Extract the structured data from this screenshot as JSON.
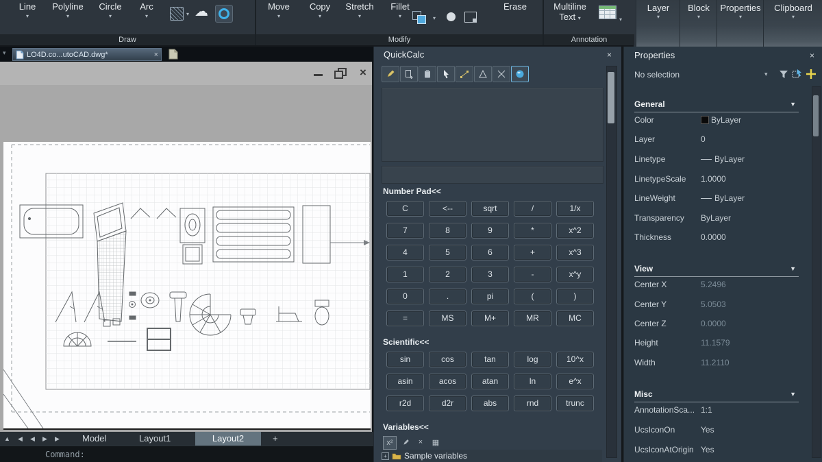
{
  "ribbon": {
    "draw": {
      "panel_label": "Draw",
      "buttons": [
        "Line",
        "Polyline",
        "Circle",
        "Arc"
      ]
    },
    "modify": {
      "panel_label": "Modify",
      "buttons": [
        "Move",
        "Copy",
        "Stretch",
        "Fillet"
      ],
      "erase": "Erase"
    },
    "annotation": {
      "panel_label": "Annotation",
      "multiline_line1": "Multiline",
      "multiline_line2": "Text"
    },
    "collapsed_panels": [
      "Layer",
      "Block",
      "Properties",
      "Clipboard"
    ]
  },
  "document_tab": {
    "title": "LO4D.co...utoCAD.dwg*"
  },
  "quickcalc": {
    "title": "QuickCalc",
    "number_pad": {
      "label": "Number Pad<<",
      "rows": [
        [
          "C",
          "<--",
          "sqrt",
          "/",
          "1/x"
        ],
        [
          "7",
          "8",
          "9",
          "*",
          "x^2"
        ],
        [
          "4",
          "5",
          "6",
          "+",
          "x^3"
        ],
        [
          "1",
          "2",
          "3",
          "-",
          "x^y"
        ],
        [
          "0",
          ".",
          "pi",
          "(",
          ")"
        ],
        [
          "=",
          "MS",
          "M+",
          "MR",
          "MC"
        ]
      ]
    },
    "scientific": {
      "label": "Scientific<<",
      "rows": [
        [
          "sin",
          "cos",
          "tan",
          "log",
          "10^x"
        ],
        [
          "asin",
          "acos",
          "atan",
          "ln",
          "e^x"
        ],
        [
          "r2d",
          "d2r",
          "abs",
          "rnd",
          "trunc"
        ]
      ]
    },
    "variables": {
      "label": "Variables<<",
      "tree_item": "Sample variables"
    }
  },
  "properties": {
    "title": "Properties",
    "selection": "No selection",
    "sections": {
      "general": {
        "label": "General",
        "rows": [
          {
            "label": "Color",
            "value": "ByLayer"
          },
          {
            "label": "Layer",
            "value": "0"
          },
          {
            "label": "Linetype",
            "value": "ByLayer"
          },
          {
            "label": "LinetypeScale",
            "value": "1.0000"
          },
          {
            "label": "LineWeight",
            "value": "ByLayer"
          },
          {
            "label": "Transparency",
            "value": "ByLayer"
          },
          {
            "label": "Thickness",
            "value": "0.0000"
          }
        ]
      },
      "view": {
        "label": "View",
        "rows": [
          {
            "label": "Center X",
            "value": "5.2496"
          },
          {
            "label": "Center Y",
            "value": "5.0503"
          },
          {
            "label": "Center Z",
            "value": "0.0000"
          },
          {
            "label": "Height",
            "value": "11.1579"
          },
          {
            "label": "Width",
            "value": "11.2110"
          }
        ]
      },
      "misc": {
        "label": "Misc",
        "rows": [
          {
            "label": "AnnotationSca...",
            "value": "1:1"
          },
          {
            "label": "UcsIconOn",
            "value": "Yes"
          },
          {
            "label": "UcsIconAtOrigin",
            "value": "Yes"
          }
        ]
      }
    }
  },
  "layout_bar": {
    "model": "Model",
    "layout1": "Layout1",
    "layout2": "Layout2",
    "add_tab": "+"
  },
  "command_line": {
    "prompt": "Command:"
  },
  "icons": {
    "caret_down": "▾",
    "close": "×",
    "cloud": "☁",
    "nav_up": "▲",
    "arrow_left": "◀",
    "arrow_right": "▶",
    "variable_new": "x²",
    "grid_calc": "▦",
    "expand_plus": "+",
    "minimize": "—"
  },
  "colors": {
    "accent_blue": "#4fb0e8",
    "tool_yellow": "#d9c36b",
    "active_layout_bg": "#64747f"
  }
}
